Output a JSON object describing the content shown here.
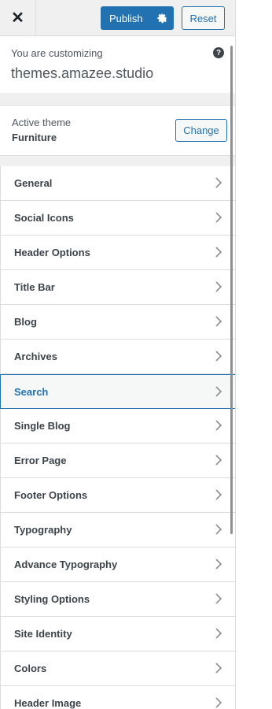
{
  "header": {
    "close_icon": "close-icon",
    "publish_label": "Publish",
    "settings_icon": "gear-icon",
    "reset_label": "Reset"
  },
  "info": {
    "prefix": "You are customizing",
    "site": "themes.amazee.studio",
    "help_icon": "help-icon",
    "help_glyph": "?"
  },
  "theme": {
    "label": "Active theme",
    "name": "Furniture",
    "change_label": "Change"
  },
  "menu": {
    "items": [
      {
        "label": "General"
      },
      {
        "label": "Social Icons"
      },
      {
        "label": "Header Options"
      },
      {
        "label": "Title Bar"
      },
      {
        "label": "Blog"
      },
      {
        "label": "Archives"
      },
      {
        "label": "Search"
      },
      {
        "label": "Single Blog"
      },
      {
        "label": "Error Page"
      },
      {
        "label": "Footer Options"
      },
      {
        "label": "Typography"
      },
      {
        "label": "Advance Typography"
      },
      {
        "label": "Styling Options"
      },
      {
        "label": "Site Identity"
      },
      {
        "label": "Colors"
      },
      {
        "label": "Header Image"
      }
    ],
    "active_label": "Search"
  },
  "colors": {
    "accent": "#2271b1",
    "text": "#3c434a",
    "muted": "#50575e",
    "border": "#dcdcde",
    "panel_bg": "#f0f0f1"
  }
}
